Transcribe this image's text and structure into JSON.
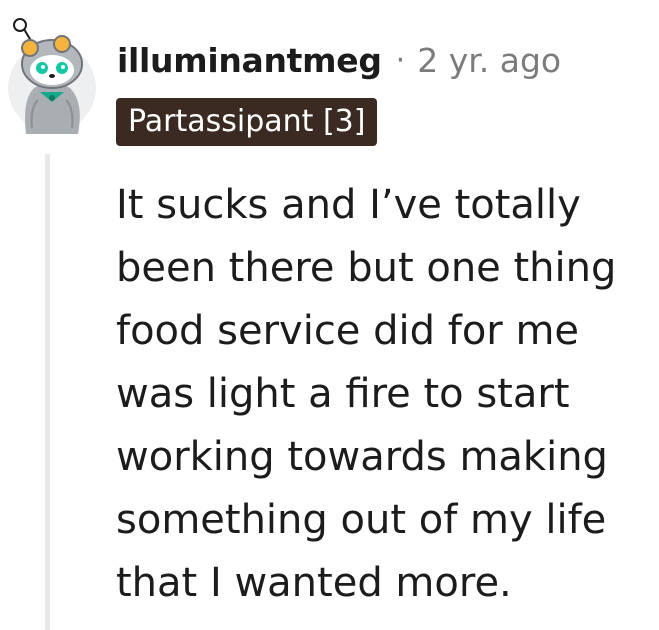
{
  "comment": {
    "author": "illuminantmeg",
    "separator": "·",
    "timestamp": "2 yr. ago",
    "flair": "Partassipant [3]",
    "body": "It sucks and I’ve totally been there but one thing food service did for me was light a fire to start working towards making something out of my life that I wanted more."
  },
  "colors": {
    "flair_background": "#3b2a21",
    "thread_line": "#e8e8e8",
    "muted_text": "#7c7c7c",
    "avatar_body": "#a9aeb2",
    "avatar_accent": "#14c8a6"
  },
  "icons": {
    "avatar": "snoo-avatar-icon"
  }
}
